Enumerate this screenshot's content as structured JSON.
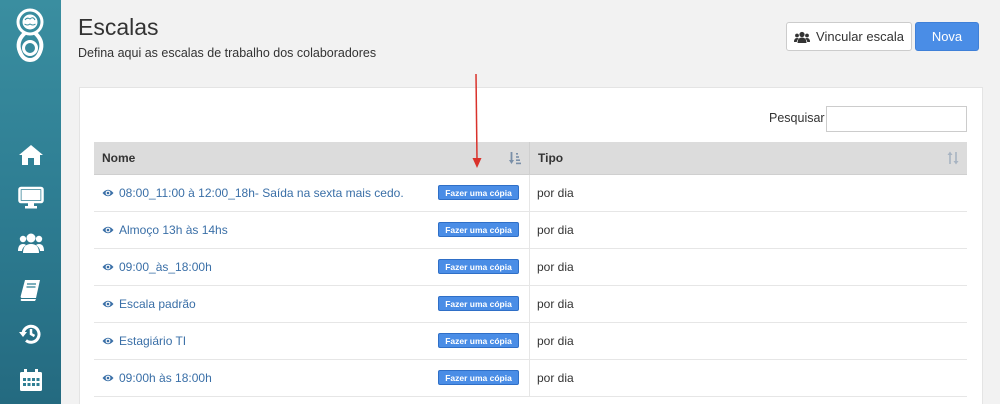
{
  "header": {
    "title": "Escalas",
    "subtitle": "Defina aqui as escalas de trabalho dos colaboradores",
    "link_button_label": "Vincular escala",
    "new_button_label": "Nova"
  },
  "sidebar": {
    "items": [
      {
        "icon": "home-icon"
      },
      {
        "icon": "monitor-icon"
      },
      {
        "icon": "users-icon"
      },
      {
        "icon": "book-icon"
      },
      {
        "icon": "history-icon"
      },
      {
        "icon": "calendar-icon"
      }
    ]
  },
  "search": {
    "label": "Pesquisar",
    "value": "",
    "placeholder": ""
  },
  "table": {
    "columns": [
      "Nome",
      "Tipo"
    ],
    "copy_label": "Fazer uma cópia",
    "rows": [
      {
        "nome": "08:00_11:00 à 12:00_18h- Saída na sexta mais cedo.",
        "tipo": "por dia"
      },
      {
        "nome": "Almoço 13h às 14hs",
        "tipo": "por dia"
      },
      {
        "nome": "09:00_às_18:00h",
        "tipo": "por dia"
      },
      {
        "nome": "Escala padrão",
        "tipo": "por dia"
      },
      {
        "nome": "Estagiário TI",
        "tipo": "por dia"
      },
      {
        "nome": "09:00h às 18:00h",
        "tipo": "por dia"
      }
    ]
  },
  "colors": {
    "sidebar": "#2f7f94",
    "primary_button": "#4a8de6",
    "link": "#3a6fa7",
    "annotation_arrow": "#d9322b"
  }
}
